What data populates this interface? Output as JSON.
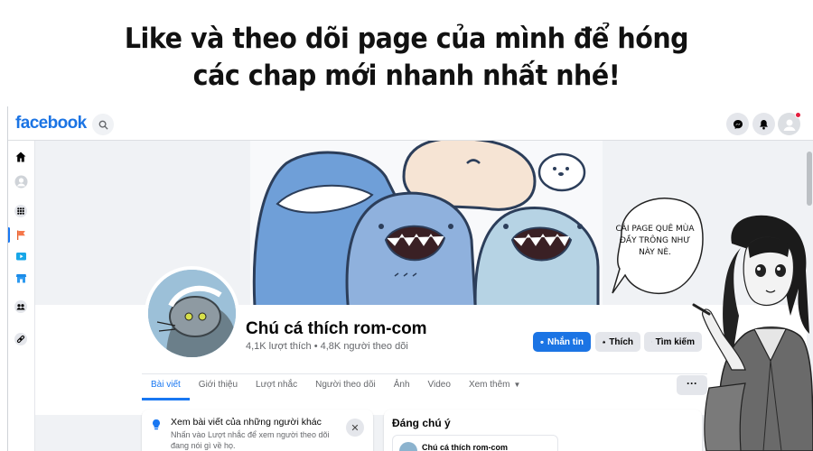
{
  "banner": {
    "line1": "Like và theo dõi page của mình để hóng",
    "line2": "các chap mới nhanh nhất nhé!"
  },
  "topbar": {
    "logo": "facebook",
    "icons": [
      "search-icon",
      "messenger-icon",
      "bell-icon",
      "profile-avatar"
    ]
  },
  "sidebar": {
    "icons": [
      "home-icon",
      "profile-icon",
      "apps-grid-icon",
      "flag-icon",
      "watch-icon",
      "marketplace-icon",
      "groups-icon",
      "link-icon"
    ]
  },
  "page": {
    "name": "Chú cá thích rom-com",
    "stats": "4,1K lượt thích • 4,8K người theo dõi",
    "buttons": {
      "message": "Nhắn tin",
      "like": "Thích",
      "search": "Tìm kiếm"
    },
    "tabs": [
      {
        "label": "Bài viết",
        "active": true
      },
      {
        "label": "Giới thiệu",
        "active": false
      },
      {
        "label": "Lượt nhắc",
        "active": false
      },
      {
        "label": "Người theo dõi",
        "active": false
      },
      {
        "label": "Ảnh",
        "active": false
      },
      {
        "label": "Video",
        "active": false
      },
      {
        "label": "Xem thêm",
        "active": false
      }
    ],
    "more_button": "···"
  },
  "feed": {
    "notice": {
      "title": "Xem bài viết của những người khác",
      "body": "Nhấn vào Lượt nhắc để xem người theo dõi đang nói gì về họ."
    },
    "featured": {
      "title": "Đáng chú ý",
      "post_author": "Chú cá thích rom-com"
    }
  },
  "speech_bubble": {
    "text": "CÁI PAGE QUÊ MÙA ĐẦY TRÔNG NHƯ NÀY NÈ."
  },
  "colors": {
    "facebook_blue": "#1b74e4",
    "page_bg": "#f0f2f5",
    "text_secondary": "#65676b"
  }
}
